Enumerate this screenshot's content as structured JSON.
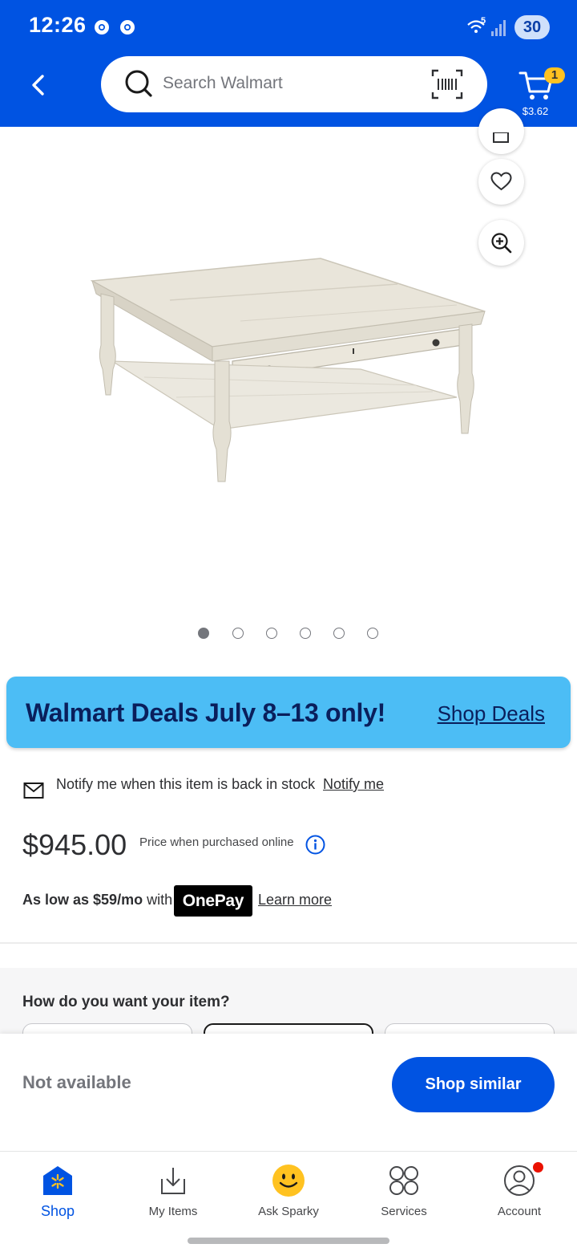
{
  "status_bar": {
    "time": "12:26",
    "network": "5",
    "battery": "30"
  },
  "header": {
    "search_placeholder": "Search Walmart",
    "cart_count": "1",
    "cart_total": "$3.62"
  },
  "gallery": {
    "image_count": 6,
    "active_index": 0
  },
  "deals_banner": {
    "title": "Walmart Deals July 8–13 only!",
    "link": "Shop Deals"
  },
  "notify": {
    "text": "Notify me when this item is back in stock",
    "link": "Notify me"
  },
  "price": {
    "amount": "$945.00",
    "note": "Price when purchased online"
  },
  "financing": {
    "prefix": "As low as $59/mo",
    "with": " with",
    "brand": "OnePay",
    "link": "Learn more"
  },
  "fulfillment": {
    "title": "How do you want your item?"
  },
  "action_bar": {
    "status": "Not available",
    "button": "Shop similar"
  },
  "bottom_nav": {
    "items": [
      {
        "label": "Shop",
        "icon": "store-icon",
        "active": true
      },
      {
        "label": "My Items",
        "icon": "my-items-icon"
      },
      {
        "label": "Ask Sparky",
        "icon": "sparky-icon"
      },
      {
        "label": "Services",
        "icon": "services-icon"
      },
      {
        "label": "Account",
        "icon": "account-icon",
        "badge": true
      }
    ]
  },
  "colors": {
    "brand_blue": "#0053e2",
    "deals_blue": "#4cbdf5",
    "spark_yellow": "#ffc220",
    "badge_red": "#ea1100"
  }
}
